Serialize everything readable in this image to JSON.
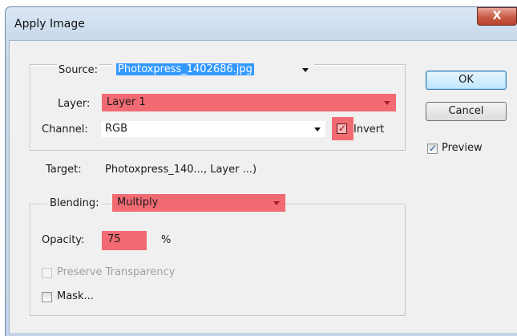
{
  "window": {
    "title": "Apply Image",
    "close_label": "X"
  },
  "source": {
    "label": "Source:",
    "value": "Photoxpress_1402686.jpg"
  },
  "layer": {
    "label": "Layer:",
    "value": "Layer 1"
  },
  "channel": {
    "label": "Channel:",
    "value": "RGB"
  },
  "invert": {
    "label": "Invert",
    "checked": true
  },
  "target": {
    "label": "Target:",
    "value": "Photoxpress_140..., Layer ...)"
  },
  "blending": {
    "label": "Blending:",
    "value": "Multiply"
  },
  "opacity": {
    "label": "Opacity:",
    "value": "75",
    "unit": "%"
  },
  "preserve_transparency": {
    "label": "Preserve Transparency",
    "enabled": false,
    "checked": false
  },
  "mask": {
    "label": "Mask...",
    "checked": false
  },
  "buttons": {
    "ok": "OK",
    "cancel": "Cancel"
  },
  "preview": {
    "label": "Preview",
    "checked": true
  },
  "colors": {
    "highlight": "#f26b73",
    "selection": "#3399ff"
  }
}
